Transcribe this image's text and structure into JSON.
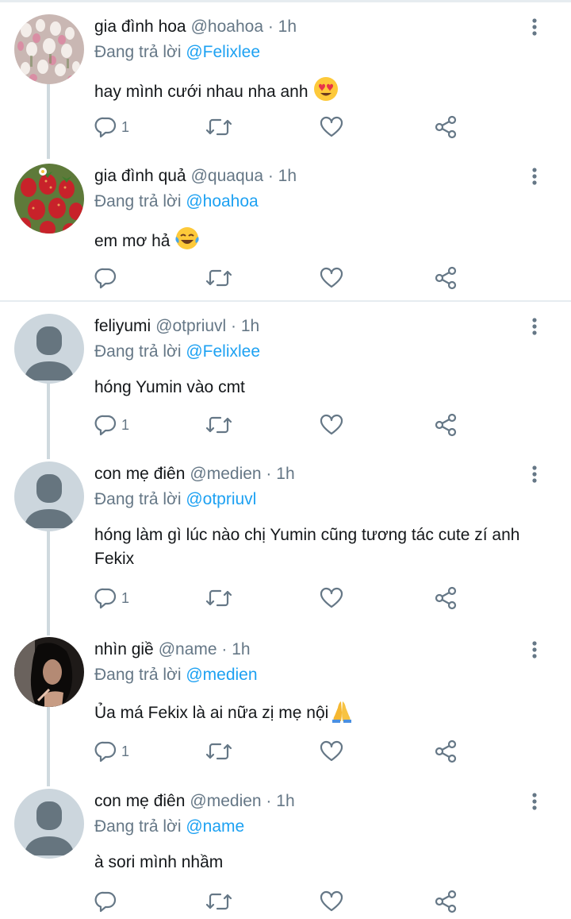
{
  "reply_prefix": "Đang trả lời",
  "tweets": [
    {
      "name": "gia đình hoa",
      "handle": "@hoahoa · 1h",
      "reply_to": "@Felixlee",
      "text": "hay mình cưới nhau nha anh",
      "emoji": "heart-eyes-emoji",
      "reply_count": "1",
      "avatar": "flowers-photo"
    },
    {
      "name": "gia đình quả",
      "handle": "@quaqua · 1h",
      "reply_to": "@hoahoa",
      "text": "em mơ hả",
      "emoji": "tears-of-joy-emoji",
      "reply_count": "",
      "avatar": "strawberries-photo"
    },
    {
      "name": "feliyumi",
      "handle": "@otpriuvl · 1h",
      "reply_to": "@Felixlee",
      "text": "hóng Yumin vào cmt",
      "emoji": "",
      "reply_count": "1",
      "avatar": "default-avatar"
    },
    {
      "name": "con mẹ điên",
      "handle": "@medien · 1h",
      "reply_to": "@otpriuvl",
      "text": "hóng làm gì lúc nào chị Yumin cũng tương tác cute zí anh Fekix",
      "emoji": "",
      "reply_count": "1",
      "avatar": "default-avatar"
    },
    {
      "name": "nhìn giề",
      "handle": "@name · 1h",
      "reply_to": "@medien",
      "text": "Ủa má Fekix là ai nữa zị mẹ nội",
      "emoji": "folded-hands-emoji",
      "reply_count": "1",
      "avatar": "dark-portrait-photo"
    },
    {
      "name": "con mẹ điên",
      "handle": "@medien · 1h",
      "reply_to": "@name",
      "text": "à sori mình nhầm",
      "emoji": "",
      "reply_count": "",
      "avatar": "default-avatar"
    }
  ]
}
